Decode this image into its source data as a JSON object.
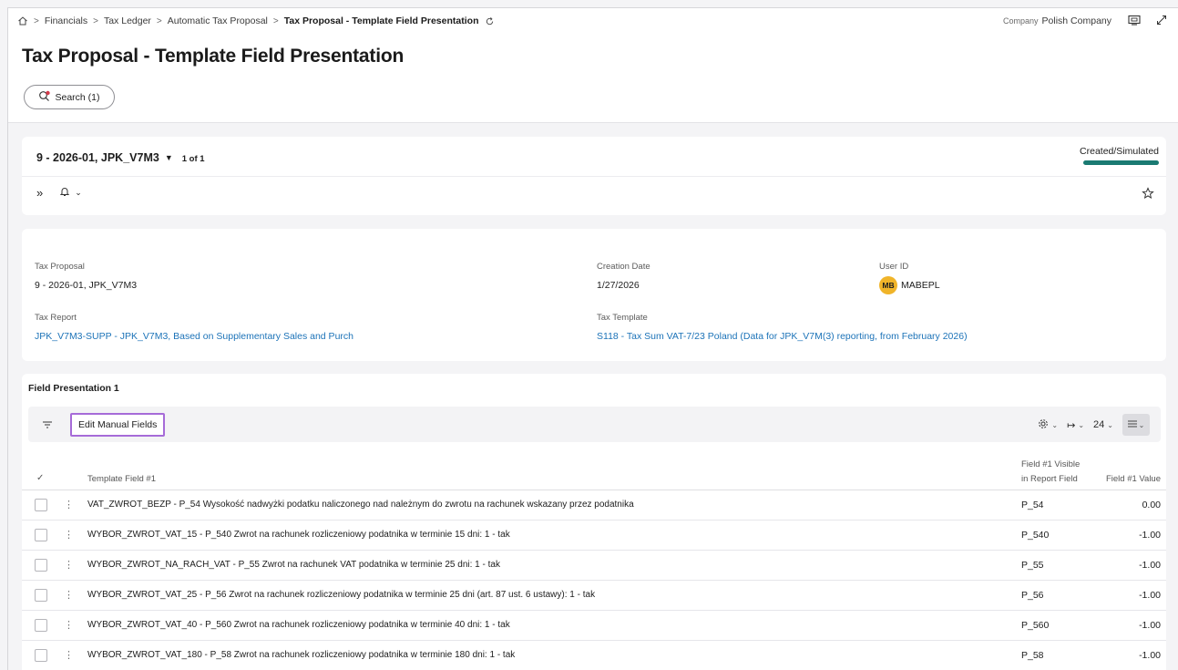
{
  "breadcrumb": {
    "items": [
      "Financials",
      "Tax Ledger",
      "Automatic Tax Proposal"
    ],
    "current": "Tax Proposal - Template Field Presentation"
  },
  "company": {
    "label": "Company",
    "value": "Polish Company"
  },
  "page_title": "Tax Proposal - Template Field Presentation",
  "search_button": "Search (1)",
  "record": {
    "title": "9 - 2026-01, JPK_V7M3",
    "count": "1 of 1",
    "status": "Created/Simulated",
    "status_color": "#1a7a72"
  },
  "details": {
    "tax_proposal": {
      "label": "Tax Proposal",
      "value": "9 - 2026-01, JPK_V7M3"
    },
    "creation_date": {
      "label": "Creation Date",
      "value": "1/27/2026"
    },
    "user_id": {
      "label": "User ID",
      "initials": "MB",
      "value": "MABEPL"
    },
    "tax_report": {
      "label": "Tax Report",
      "value": "JPK_V7M3-SUPP - JPK_V7M3, Based on Supplementary Sales and Purch"
    },
    "tax_template": {
      "label": "Tax Template",
      "value": "S118 - Tax Sum VAT-7/23 Poland (Data for JPK_V7M(3) reporting, from February 2026)"
    }
  },
  "list": {
    "section_title": "Field Presentation 1",
    "edit_button": "Edit Manual Fields",
    "page_size": "24",
    "columns": {
      "template_field": "Template Field #1",
      "visible_line1": "Field #1 Visible",
      "visible_line2": "in Report Field",
      "value": "Field #1 Value"
    },
    "rows": [
      {
        "field": "VAT_ZWROT_BEZP - P_54 Wysokość nadwyżki podatku naliczonego nad należnym do zwrotu na rachunek wskazany przez podatnika",
        "report_field": "P_54",
        "value": "0.00"
      },
      {
        "field": "WYBOR_ZWROT_VAT_15 - P_540 Zwrot na rachunek rozliczeniowy podatnika w terminie 15 dni: 1 - tak",
        "report_field": "P_540",
        "value": "-1.00"
      },
      {
        "field": "WYBOR_ZWROT_NA_RACH_VAT - P_55 Zwrot na rachunek VAT podatnika w terminie 25 dni: 1 - tak",
        "report_field": "P_55",
        "value": "-1.00"
      },
      {
        "field": "WYBOR_ZWROT_VAT_25 - P_56 Zwrot na rachunek rozliczeniowy podatnika w terminie 25 dni (art. 87 ust. 6 ustawy): 1 - tak",
        "report_field": "P_56",
        "value": "-1.00"
      },
      {
        "field": "WYBOR_ZWROT_VAT_40 - P_560 Zwrot na rachunek rozliczeniowy podatnika w terminie 40 dni: 1 - tak",
        "report_field": "P_560",
        "value": "-1.00"
      },
      {
        "field": "WYBOR_ZWROT_VAT_180 - P_58 Zwrot na rachunek rozliczeniowy podatnika w terminie 180 dni: 1 - tak",
        "report_field": "P_58",
        "value": "-1.00"
      }
    ]
  },
  "colors": {
    "link": "#1c73b8",
    "accent_border": "#a66bd8",
    "avatar": "#f0b429"
  }
}
